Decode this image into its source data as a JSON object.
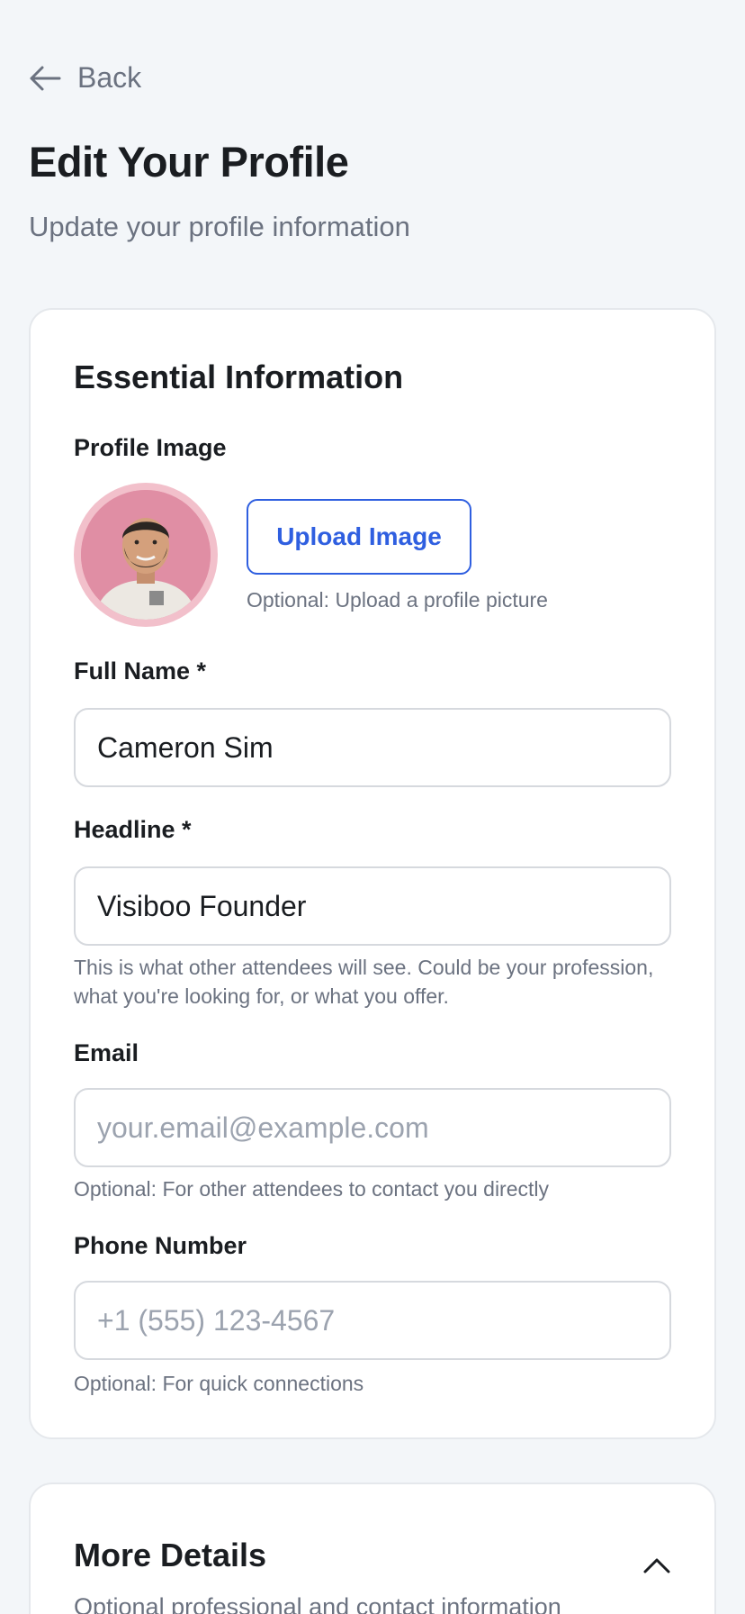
{
  "nav": {
    "back_label": "Back",
    "back_icon": "arrow-left-icon"
  },
  "header": {
    "title": "Edit Your Profile",
    "subtitle": "Update your profile information"
  },
  "essential": {
    "title": "Essential Information",
    "profile_image": {
      "label": "Profile Image",
      "upload_label": "Upload Image",
      "helper": "Optional: Upload a profile picture"
    },
    "full_name": {
      "label": "Full Name *",
      "value": "Cameron Sim"
    },
    "headline": {
      "label": "Headline *",
      "value": "Visiboo Founder",
      "helper": "This is what other attendees will see. Could be your profession, what you're looking for, or what you offer."
    },
    "email": {
      "label": "Email",
      "value": "",
      "placeholder": "your.email@example.com",
      "helper": "Optional: For other attendees to contact you directly"
    },
    "phone": {
      "label": "Phone Number",
      "value": "",
      "placeholder": "+1 (555) 123-4567",
      "helper": "Optional: For quick connections"
    }
  },
  "more_details": {
    "title": "More Details",
    "subtitle": "Optional professional and contact information",
    "toggle_icon": "chevron-up-icon"
  },
  "colors": {
    "background": "#f3f6f9",
    "accent": "#2f5fe0",
    "avatar_ring": "#f2c0cb",
    "muted_text": "#6b7280"
  }
}
